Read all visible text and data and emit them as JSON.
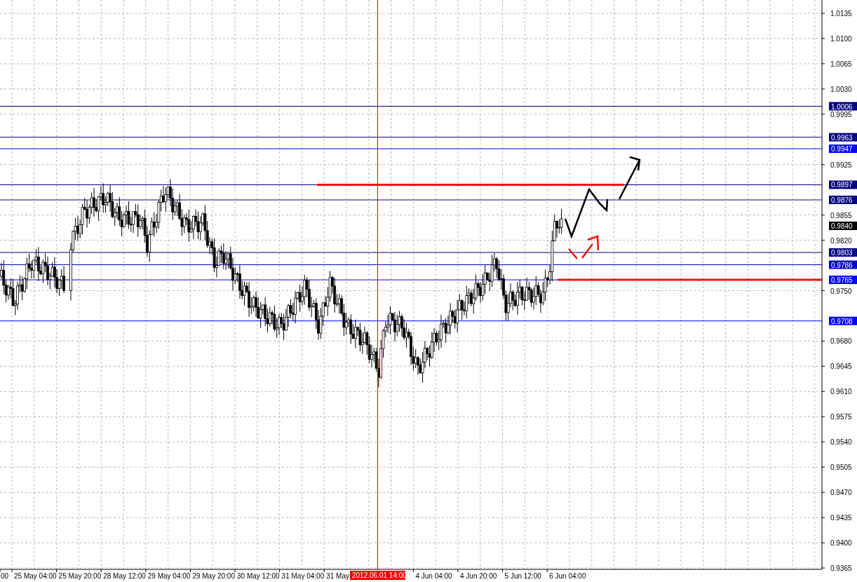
{
  "price_axis": {
    "ticks": [
      "1.0135",
      "1.0100",
      "1.0065",
      "1.0030",
      "0.9995",
      "0.9925",
      "0.9855",
      "0.9820",
      "0.9750",
      "0.9680",
      "0.9645",
      "0.9610",
      "0.9575",
      "0.9540",
      "0.9505",
      "0.9470",
      "0.9435",
      "0.9400",
      "0.9365"
    ]
  },
  "levels": [
    {
      "price": "1.0006",
      "color": "#000080"
    },
    {
      "price": "0.9963",
      "color": "#000080"
    },
    {
      "price": "0.9947",
      "color": "#0000ff"
    },
    {
      "price": "0.9897",
      "color": "#000080"
    },
    {
      "price": "0.9876",
      "color": "#000080"
    },
    {
      "price": "0.9803",
      "color": "#000080"
    },
    {
      "price": "0.9786",
      "color": "#0000cc"
    },
    {
      "price": "0.9765",
      "color": "#0000ff"
    },
    {
      "price": "0.9708",
      "color": "#0000ff"
    }
  ],
  "current_price": "0.9840",
  "time_axis": {
    "labels": [
      "00",
      "25 May 04:00",
      "25 May 20:00",
      "28 May 12:00",
      "29 May 04:00",
      "29 May 20:00",
      "30 May 12:00",
      "31 May 04:00",
      "31 May",
      "4 Jun 04:00",
      "4 Jun 20:00",
      "5 Jun 12:00",
      "6 Jun 04:00"
    ]
  },
  "crosshair": {
    "time": "2012.06.01 14:00"
  }
}
